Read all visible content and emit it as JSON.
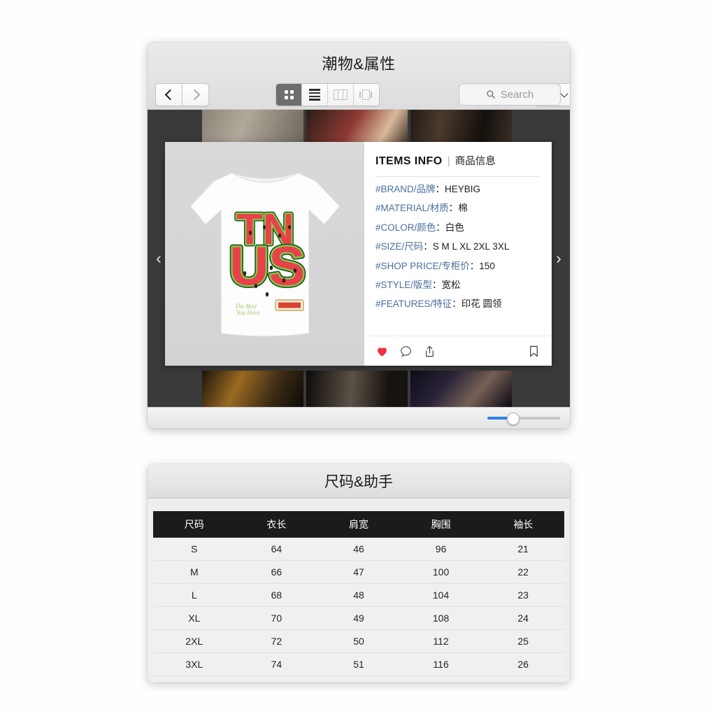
{
  "window1": {
    "title": "潮物&属性",
    "toolbar": {
      "back_label": "‹",
      "forward_label": "›",
      "views": [
        {
          "name": "icon-view",
          "label": "Icon View",
          "active": true
        },
        {
          "name": "list-view",
          "label": "List View",
          "active": false
        },
        {
          "name": "column-view",
          "label": "Column View",
          "active": false
        },
        {
          "name": "gallery-view",
          "label": "Gallery View",
          "active": false
        }
      ],
      "gear_label": "Action",
      "search_placeholder": "Search",
      "search_value": ""
    },
    "carousel": {
      "prev_label": "‹",
      "next_label": "›"
    },
    "card": {
      "header_en": "ITEMS INFO",
      "header_divider": "|",
      "header_cn": "商品信息",
      "attributes": [
        {
          "key": "#BRAND/品牌",
          "sep": "：",
          "value": "HEYBIG"
        },
        {
          "key": "#MATERIAL/材质",
          "sep": "：",
          "value": "棉"
        },
        {
          "key": "#COLOR/颜色",
          "sep": "：",
          "value": "白色"
        },
        {
          "key": "#SIZE/尺码",
          "sep": "：",
          "value": "S M L XL 2XL 3XL"
        },
        {
          "key": "#SHOP PRICE/专柜价",
          "sep": "：",
          "value": "150"
        },
        {
          "key": "#STYLE/版型",
          "sep": "：",
          "value": "宽松"
        },
        {
          "key": "#FEATURES/特征",
          "sep": "：",
          "value": "印花 圆领"
        }
      ],
      "actions": [
        {
          "name": "like-icon",
          "label": "Like"
        },
        {
          "name": "comment-icon",
          "label": "Comment"
        },
        {
          "name": "share-icon",
          "label": "Share"
        },
        {
          "name": "bookmark-icon",
          "label": "Bookmark"
        }
      ],
      "product_graphic_text_line1": "TN",
      "product_graphic_text_line2": "US"
    },
    "slider": {
      "value": 30,
      "min": 0,
      "max": 100
    }
  },
  "window2": {
    "title": "尺码&助手",
    "table": {
      "headers": [
        "尺码",
        "衣长",
        "肩宽",
        "胸围",
        "袖长"
      ],
      "rows": [
        [
          "S",
          "64",
          "46",
          "96",
          "21"
        ],
        [
          "M",
          "66",
          "47",
          "100",
          "22"
        ],
        [
          "L",
          "68",
          "48",
          "104",
          "23"
        ],
        [
          "XL",
          "70",
          "49",
          "108",
          "24"
        ],
        [
          "2XL",
          "72",
          "50",
          "112",
          "25"
        ],
        [
          "3XL",
          "74",
          "51",
          "116",
          "26"
        ]
      ]
    }
  },
  "colors": {
    "accent_blue": "#2b7ff0",
    "label_blue": "#4a6f9e",
    "like_red": "#ef3340",
    "table_header_bg": "#1b1b1b",
    "content_bg": "#3a3a3a"
  }
}
